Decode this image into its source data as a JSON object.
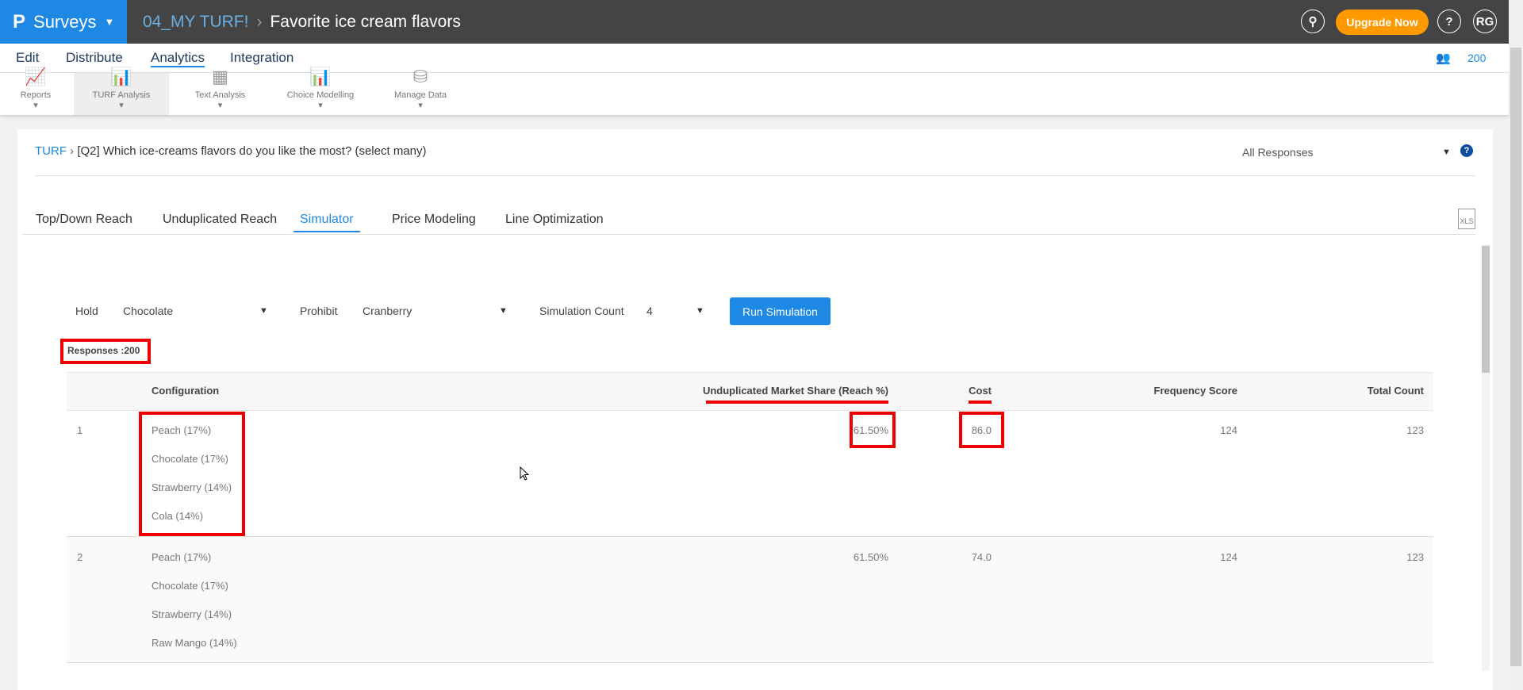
{
  "app": {
    "name": "Surveys",
    "project": "04_MY TURF!",
    "survey": "Favorite ice cream flavors",
    "upgrade": "Upgrade Now",
    "help": "?",
    "user": "RG"
  },
  "nav": {
    "items": [
      "Edit",
      "Distribute",
      "Analytics",
      "Integration"
    ],
    "active": "Analytics",
    "respondents": "200"
  },
  "toolbar": [
    {
      "label": "Reports",
      "icon": "line-chart-icon"
    },
    {
      "label": "TURF Analysis",
      "icon": "turf-chart-icon"
    },
    {
      "label": "Text Analysis",
      "icon": "text-analysis-icon"
    },
    {
      "label": "Choice Modelling",
      "icon": "choice-chart-icon"
    },
    {
      "label": "Manage Data",
      "icon": "database-icon"
    }
  ],
  "breadcrumb": {
    "root": "TURF",
    "question": "[Q2] Which ice-creams flavors do you like the most? (select many)"
  },
  "filter": "All Responses",
  "tabs": [
    "Top/Down Reach",
    "Unduplicated Reach",
    "Simulator",
    "Price Modeling",
    "Line Optimization"
  ],
  "active_tab": "Simulator",
  "export": "XLS",
  "controls": {
    "hold_label": "Hold",
    "hold_value": "Chocolate",
    "prohibit_label": "Prohibit",
    "prohibit_value": "Cranberry",
    "count_label": "Simulation Count",
    "count_value": "4",
    "run": "Run Simulation"
  },
  "responses": "Responses :200",
  "table": {
    "headers": [
      "Configuration",
      "Unduplicated Market Share (Reach %)",
      "Cost",
      "Frequency Score",
      "Total Count"
    ],
    "rows": [
      {
        "n": "1",
        "config": [
          "Peach (17%)",
          "Chocolate (17%)",
          "Strawberry (14%)",
          "Cola (14%)"
        ],
        "reach": "61.50%",
        "cost": "86.0",
        "freq": "124",
        "total": "123"
      },
      {
        "n": "2",
        "config": [
          "Peach (17%)",
          "Chocolate (17%)",
          "Strawberry (14%)",
          "Raw Mango (14%)"
        ],
        "reach": "61.50%",
        "cost": "74.0",
        "freq": "124",
        "total": "123"
      }
    ]
  },
  "colors": {
    "brand": "#1e88e5",
    "upgrade": "#ff9900",
    "highlight": "#e00000"
  }
}
